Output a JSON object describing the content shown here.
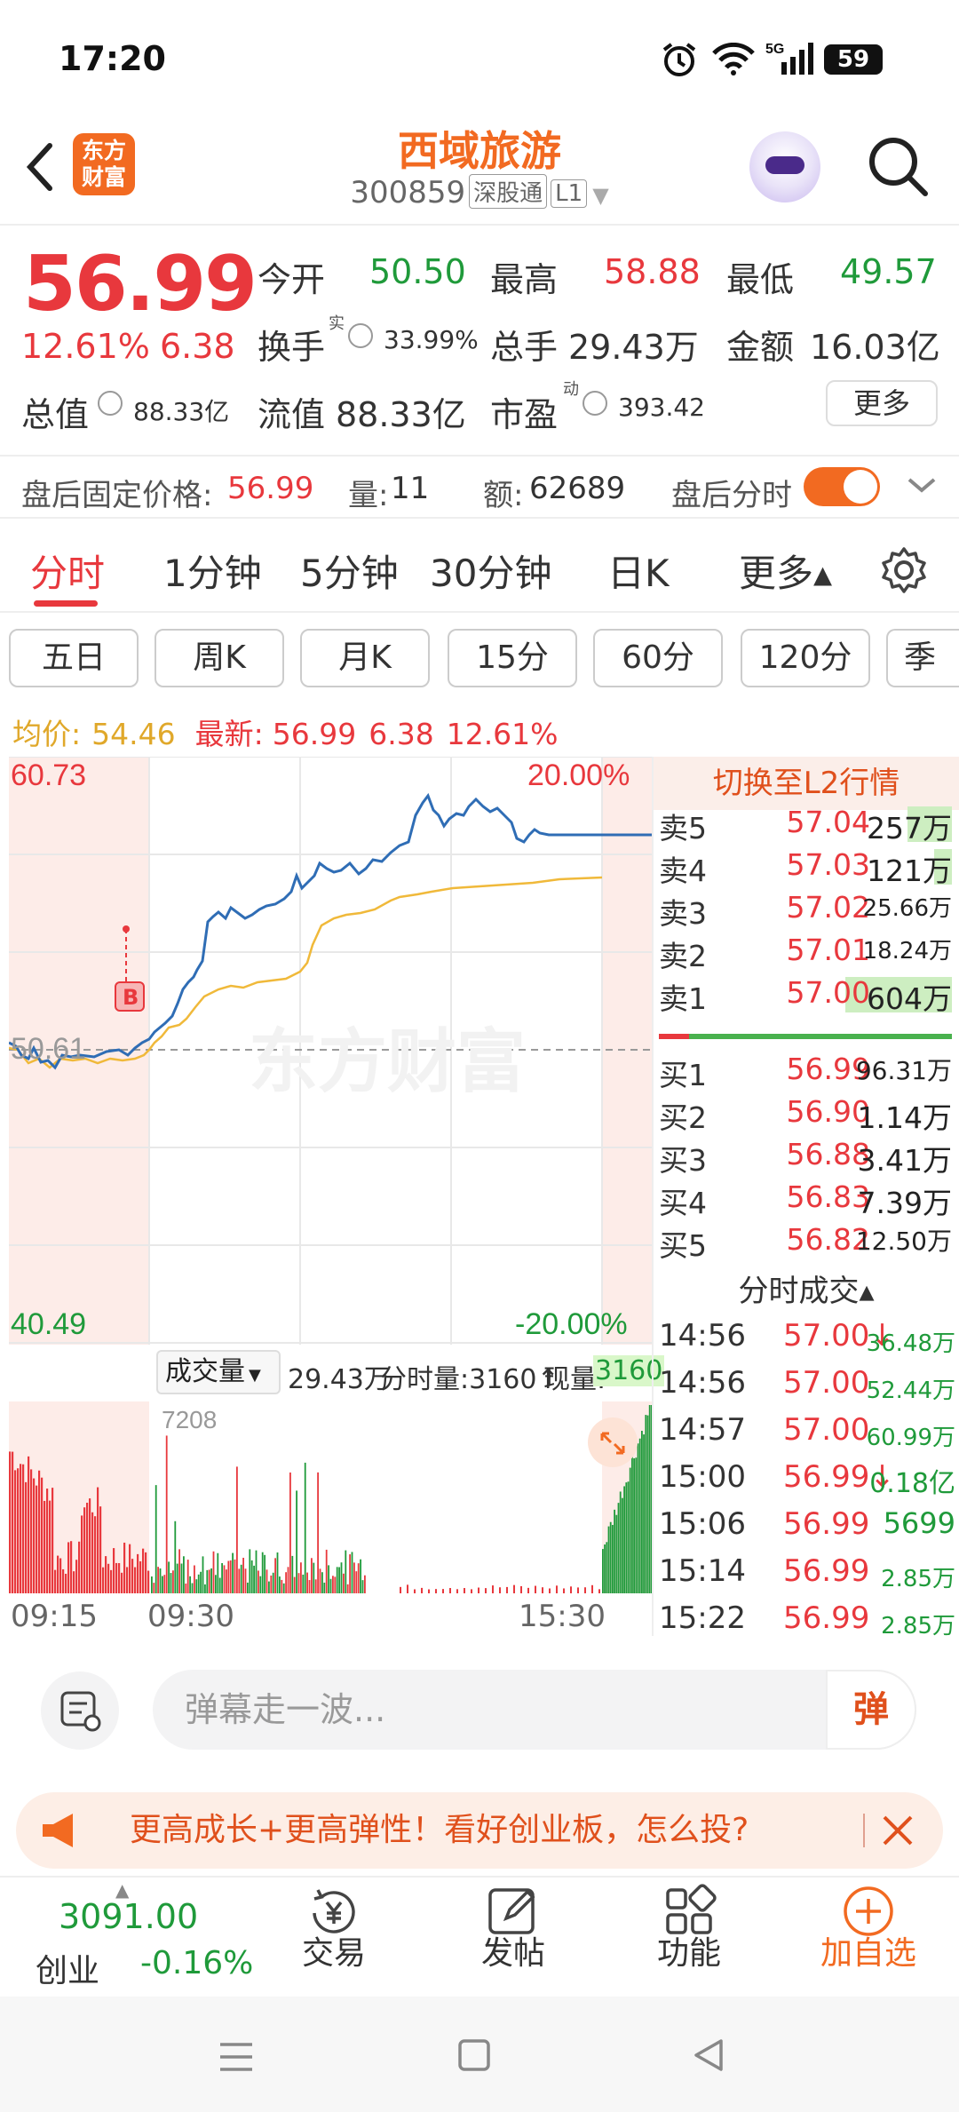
{
  "status_bar": {
    "time": "17:20",
    "battery": "59"
  },
  "header": {
    "logo_line1": "东方",
    "logo_line2": "财富",
    "stock_name": "西域旅游",
    "stock_code": "300859",
    "exchange_tag": "深股通",
    "level_tag": "L1"
  },
  "quote": {
    "price": "56.99",
    "change_pct": "12.61%",
    "change": "6.38",
    "open_label": "今开",
    "open": "50.50",
    "high_label": "最高",
    "high": "58.88",
    "low_label": "最低",
    "low": "49.57",
    "turnover_label": "换手",
    "turnover_sup": "实",
    "turnover": "33.99%",
    "volume_label": "总手",
    "volume": "29.43万",
    "amount_label": "金额",
    "amount": "16.03亿",
    "mktcap_label": "总值",
    "mktcap": "88.33亿",
    "float_label": "流值",
    "float": "88.33亿",
    "pe_label": "市盈",
    "pe_sup": "动",
    "pe": "393.42",
    "more_button": "更多"
  },
  "after_hours": {
    "price_label": "盘后固定价格:",
    "price": "56.99",
    "vol_label": "量:",
    "vol": "11",
    "amt_label": "额:",
    "amt": "62689",
    "toggle_label": "盘后分时",
    "toggle_on": true
  },
  "tabs": [
    "分时",
    "1分钟",
    "5分钟",
    "30分钟",
    "日K",
    "更多▴"
  ],
  "period_pills": [
    "五日",
    "周K",
    "月K",
    "15分",
    "60分",
    "120分",
    "季"
  ],
  "chart_header": {
    "avg_label": "均价:",
    "avg": "54.46",
    "latest_label": "最新:",
    "latest": "56.99",
    "latest_chg": "6.38",
    "latest_pct": "12.61%"
  },
  "chart_labels": {
    "top_left": "60.73",
    "top_right": "20.00%",
    "mid_left": "50.61",
    "bottom_left": "40.49",
    "bottom_right": "-20.00%",
    "marker": "B",
    "watermark": "东方财富"
  },
  "volume_header": {
    "label": "成交量",
    "total": "29.43万",
    "tick_vol": "分时量:3160↑",
    "now_label": "现量:",
    "now": "3160",
    "max_label": "7208"
  },
  "time_axis": [
    "09:15",
    "09:30",
    "15:30"
  ],
  "l2_switch": "切换至L2行情",
  "order_book": {
    "asks": [
      {
        "label": "卖5",
        "price": "57.04",
        "vol": "257万"
      },
      {
        "label": "卖4",
        "price": "57.03",
        "vol": "121万"
      },
      {
        "label": "卖3",
        "price": "57.02",
        "vol": "25.66万"
      },
      {
        "label": "卖2",
        "price": "57.01",
        "vol": "18.24万"
      },
      {
        "label": "卖1",
        "price": "57.00",
        "vol": "604万"
      }
    ],
    "bids": [
      {
        "label": "买1",
        "price": "56.99",
        "vol": "96.31万"
      },
      {
        "label": "买2",
        "price": "56.90",
        "vol": "1.14万"
      },
      {
        "label": "买3",
        "price": "56.88",
        "vol": "3.41万"
      },
      {
        "label": "买4",
        "price": "56.83",
        "vol": "7.39万"
      },
      {
        "label": "买5",
        "price": "56.82",
        "vol": "12.50万"
      }
    ]
  },
  "ticks_title": "分时成交▴",
  "ticks": [
    {
      "time": "14:56",
      "price": "57.00↓",
      "vol": "36.48万"
    },
    {
      "time": "14:56",
      "price": "57.00",
      "vol": "52.44万"
    },
    {
      "time": "14:57",
      "price": "57.00",
      "vol": "60.99万"
    },
    {
      "time": "15:00",
      "price": "56.99↓",
      "vol": "0.18亿"
    },
    {
      "time": "15:06",
      "price": "56.99",
      "vol": "5699"
    },
    {
      "time": "15:14",
      "price": "56.99",
      "vol": "2.85万"
    },
    {
      "time": "15:22",
      "price": "56.99",
      "vol": "2.85万"
    }
  ],
  "danmu": {
    "placeholder": "弹幕走一波...",
    "button": "弹"
  },
  "banner": {
    "text": "更高成长+更高弹性！看好创业板，怎么投?"
  },
  "bottom_bar": {
    "index_value": "3091.00",
    "index_name": "创业",
    "index_pct": "-0.16%",
    "trade": "交易",
    "post": "发帖",
    "functions": "功能",
    "add_watch": "加自选"
  },
  "colors": {
    "up": "#e8383d",
    "down": "#1f9a3a",
    "brand": "#f26a21",
    "price_line": "#2f6db5",
    "avg_line": "#f0b93a"
  }
}
